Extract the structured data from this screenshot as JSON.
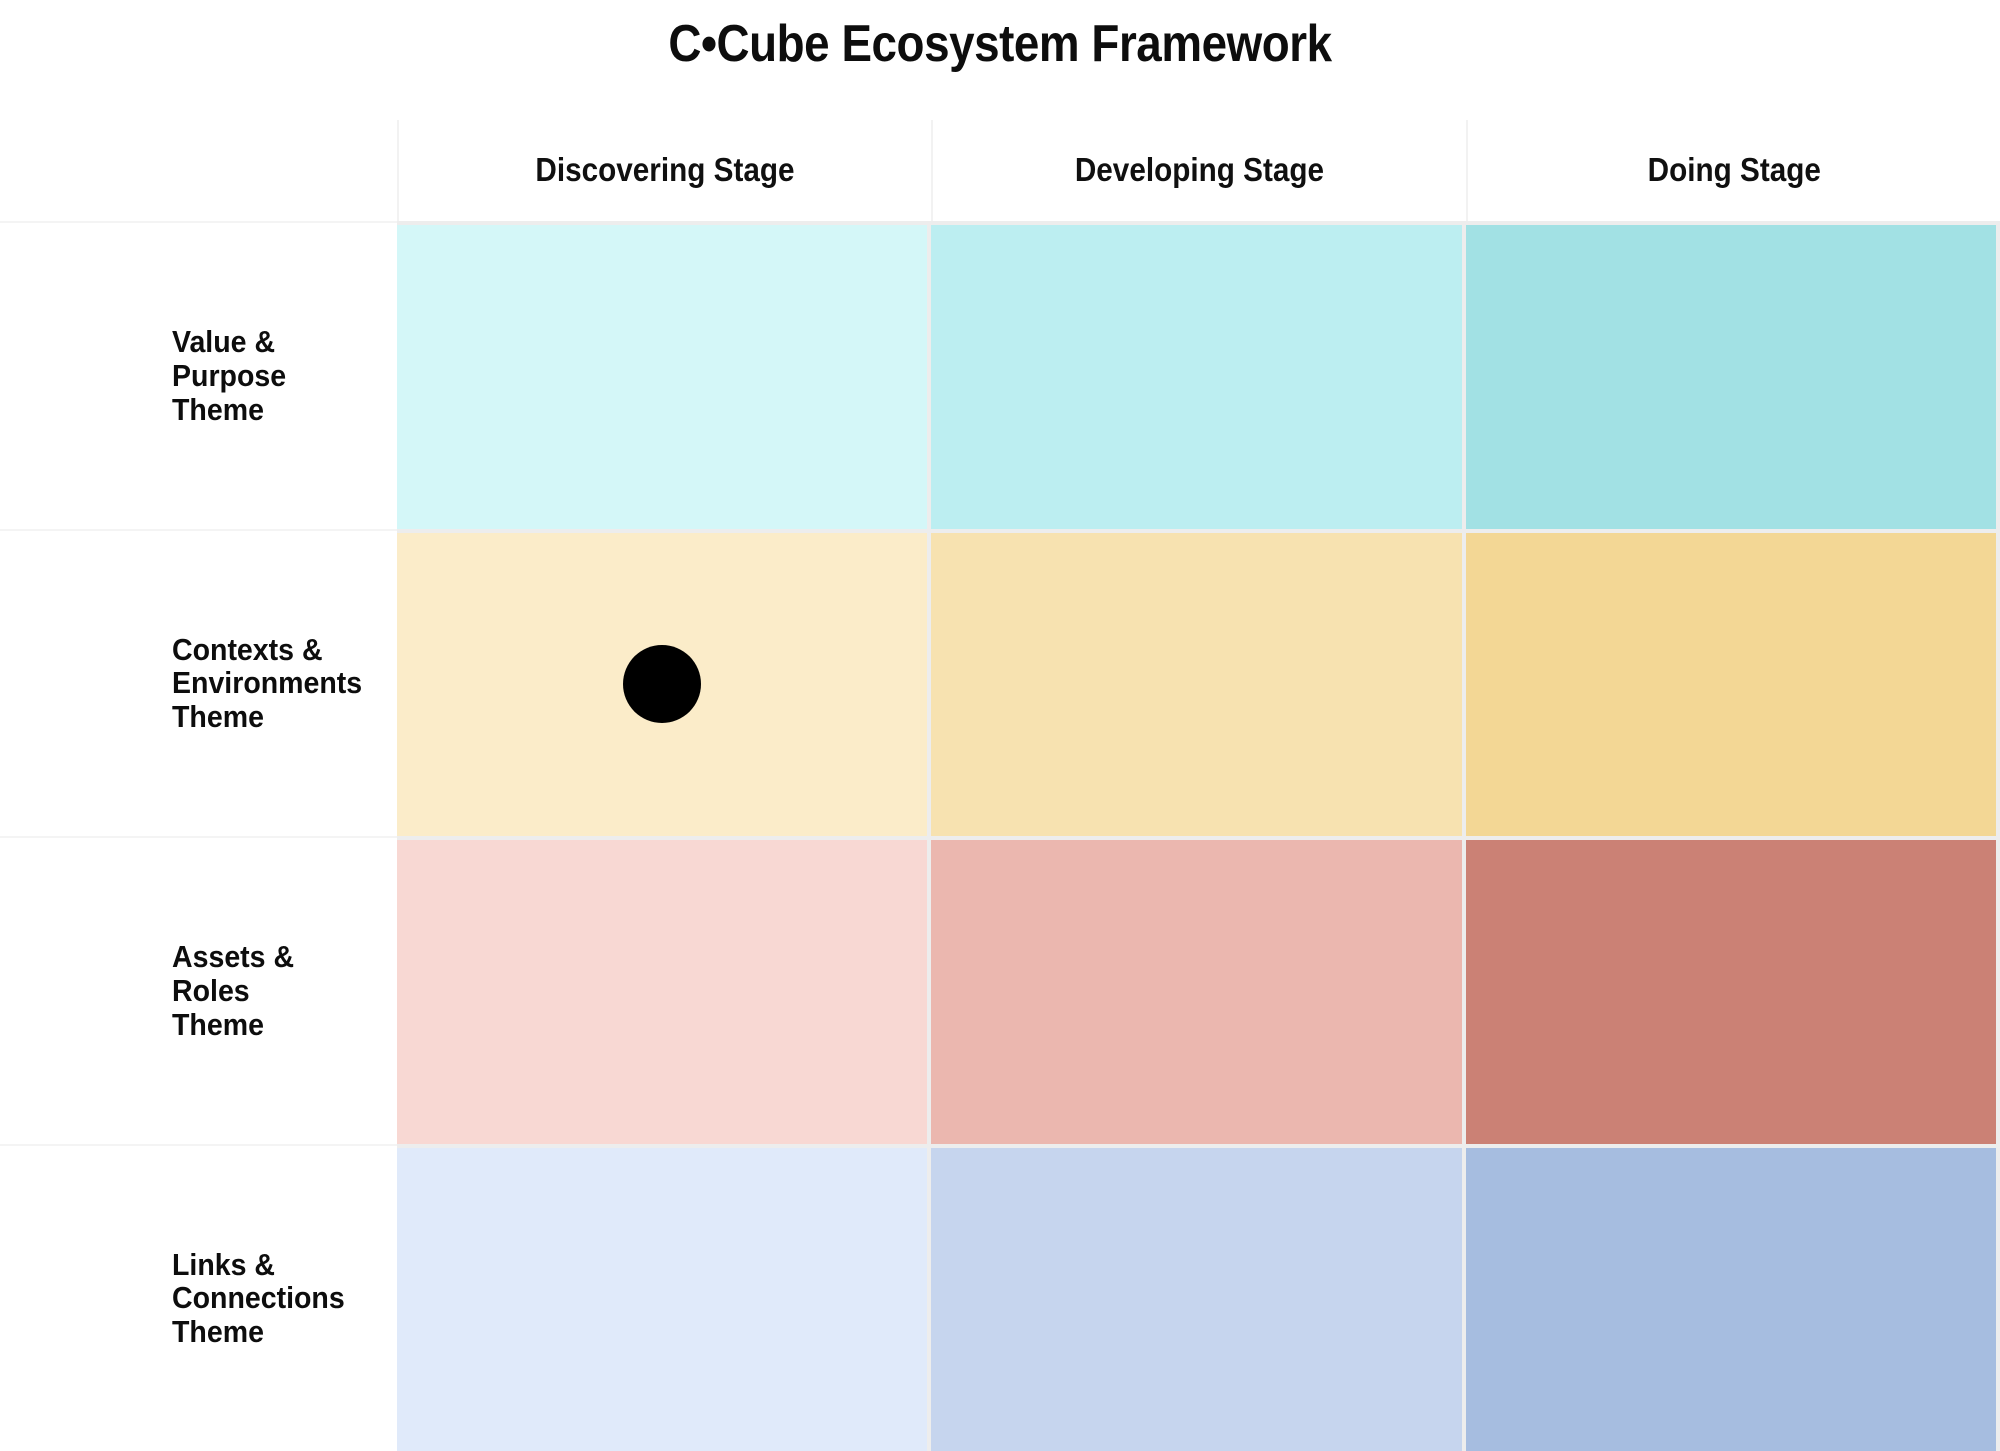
{
  "title": "C•Cube Ecosystem Framework",
  "columns": [
    {
      "label": "Discovering Stage"
    },
    {
      "label": "Developing Stage"
    },
    {
      "label": "Doing Stage"
    }
  ],
  "rows": [
    {
      "label": "Value & Purpose\nTheme",
      "cells": [
        {
          "color": "#d4f7f8",
          "marker": false
        },
        {
          "color": "#bceef1",
          "marker": false
        },
        {
          "color": "#a2e1e4",
          "marker": false
        }
      ]
    },
    {
      "label": "Contexts &\nEnvironments\nTheme",
      "cells": [
        {
          "color": "#fbecc9",
          "marker": true
        },
        {
          "color": "#f7e2b0",
          "marker": false
        },
        {
          "color": "#f3d795",
          "marker": false
        }
      ]
    },
    {
      "label": "Assets & Roles\nTheme",
      "cells": [
        {
          "color": "#f8d8d3",
          "marker": false
        },
        {
          "color": "#ebb7af",
          "marker": false
        },
        {
          "color": "#cb8175",
          "marker": false
        }
      ]
    },
    {
      "label": "Links &\nConnections\nTheme",
      "cells": [
        {
          "color": "#e0eafa",
          "marker": false
        },
        {
          "color": "#c6d5ee",
          "marker": false
        },
        {
          "color": "#a6bde0",
          "marker": false
        }
      ]
    }
  ],
  "colors": {
    "background": "#ffffff",
    "grid_gap": "#ededed",
    "divider": "#f2f2f2",
    "marker": "#000000",
    "text": "#0d0d0d"
  },
  "chart_data": {
    "type": "heatmap",
    "title": "C•Cube Ecosystem Framework",
    "xlabel": "",
    "ylabel": "",
    "grid": true,
    "legend": "none",
    "categories": [
      "Discovering Stage",
      "Developing Stage",
      "Doing Stage"
    ],
    "row_categories": [
      "Value & Purpose Theme",
      "Contexts & Environments Theme",
      "Assets & Roles Theme",
      "Links & Connections Theme"
    ],
    "values": [
      [
        1,
        2,
        3
      ],
      [
        1,
        2,
        3
      ],
      [
        1,
        2,
        3
      ],
      [
        1,
        2,
        3
      ]
    ],
    "cell_colors": [
      [
        "#d4f7f8",
        "#bceef1",
        "#a2e1e4"
      ],
      [
        "#fbecc9",
        "#f7e2b0",
        "#f3d795"
      ],
      [
        "#f8d8d3",
        "#ebb7af",
        "#cb8175"
      ],
      [
        "#e0eafa",
        "#c6d5ee",
        "#a6bde0"
      ]
    ],
    "annotations": [
      {
        "type": "marker-dot",
        "shape": "circle",
        "color": "#000000",
        "row": "Contexts & Environments Theme",
        "column": "Discovering Stage"
      }
    ]
  }
}
